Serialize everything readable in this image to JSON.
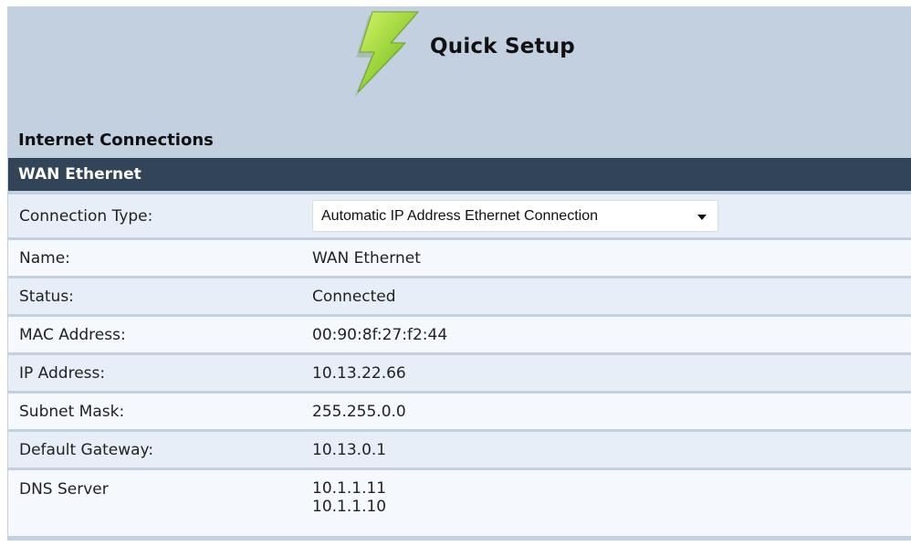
{
  "header": {
    "title": "Quick Setup",
    "icon": "lightning-bolt-icon"
  },
  "section": {
    "label": "Internet Connections"
  },
  "panel": {
    "title": "WAN Ethernet",
    "rows": {
      "connection_type": {
        "label": "Connection Type:",
        "value": "Automatic IP Address Ethernet Connection"
      },
      "name": {
        "label": "Name:",
        "value": "WAN Ethernet"
      },
      "status": {
        "label": "Status:",
        "value": "Connected",
        "color": "#2d8a2d"
      },
      "mac": {
        "label": "MAC Address:",
        "value": "00:90:8f:27:f2:44"
      },
      "ip": {
        "label": "IP Address:",
        "value": "10.13.22.66"
      },
      "subnet": {
        "label": "Subnet Mask:",
        "value": "255.255.0.0"
      },
      "gateway": {
        "label": "Default Gateway:",
        "value": "10.13.0.1"
      },
      "dns": {
        "label": "DNS Server",
        "values": [
          "10.1.1.11",
          "10.1.1.10"
        ]
      }
    }
  },
  "colors": {
    "background": "#c3d0df",
    "panel_bar": "#324458",
    "row_odd": "#e7eef7",
    "row_even": "#f5f8fc",
    "status_ok": "#2d8a2d"
  }
}
